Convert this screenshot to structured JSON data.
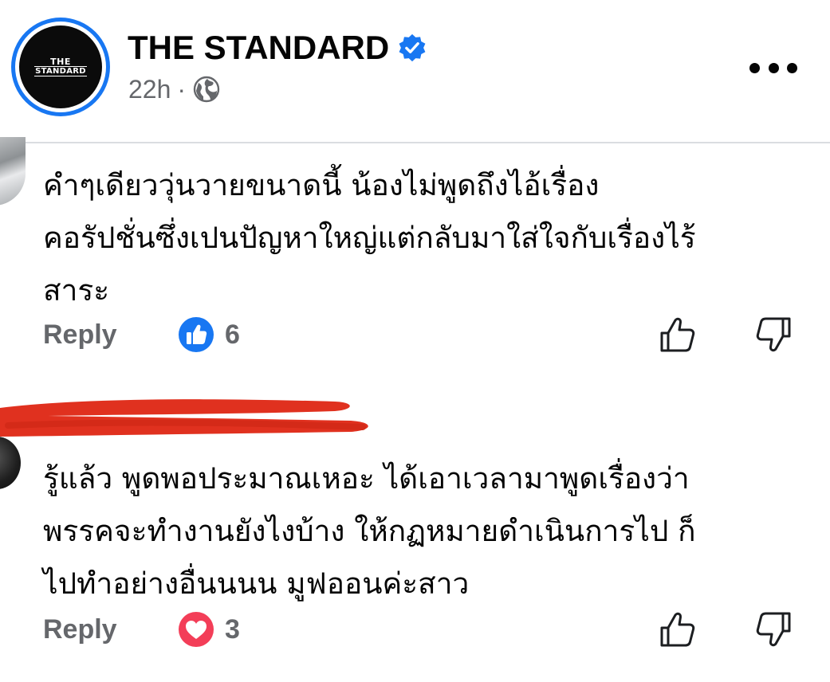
{
  "post": {
    "page_name": "THE STANDARD",
    "logo_line1": "THE",
    "logo_line2": "STANDARD",
    "time": "22h",
    "separator": "·",
    "icons": {
      "verified": "verified-badge-icon",
      "audience": "globe-icon",
      "menu": "more-icon"
    },
    "accent_color": "#1877f2"
  },
  "comments": [
    {
      "text": "คำๆเดียววุ่นวายขนาดนี้ น้องไม่พูดถึงไอ้เรื่อง\nคอรัปชั่นซึ่งเปนปัญหาใหญ่แต่กลับมาใส่ใจกับเรื่องไร้\nสาระ",
      "reply_label": "Reply",
      "reaction": "like",
      "reaction_color": "#1877f2",
      "reaction_count": "6"
    },
    {
      "text": "รู้แล้ว พูดพอประมาณเหอะ ได้เอาเวลามาพูดเรื่องว่า\nพรรคจะทำงานยังไงบ้าง ให้กฏหมายดำเนินการไป ก็\nไปทำอย่างอื่นนนน มูฟออนค่ะสาว",
      "reply_label": "Reply",
      "reaction": "love",
      "reaction_color": "#f33e58",
      "reaction_count": "3",
      "name_redacted": true,
      "redaction_color": "#e0311f"
    }
  ]
}
